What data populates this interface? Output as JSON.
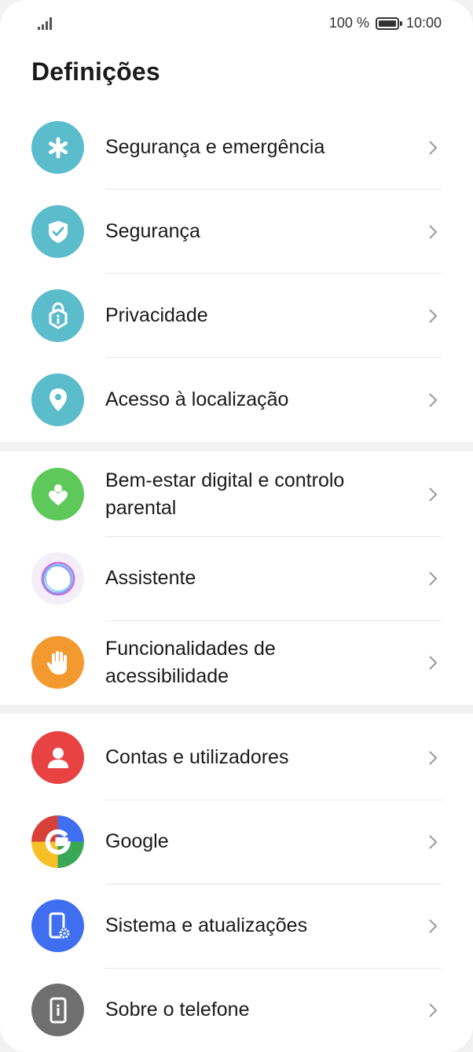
{
  "status_bar": {
    "battery_text": "100 %",
    "time": "10:00",
    "signal_icon": "signal-icon",
    "battery_icon": "battery-icon"
  },
  "page": {
    "title": "Definições"
  },
  "colors": {
    "teal": "#5bbccb",
    "green": "#5ec95a",
    "orange": "#f39a2f",
    "red": "#e84242",
    "blue": "#3f6ff0",
    "gray": "#6f6f6f"
  },
  "settings": {
    "items": [
      {
        "label": "Segurança e emergência",
        "icon": "asterisk-icon"
      },
      {
        "label": "Segurança",
        "icon": "shield-check-icon"
      },
      {
        "label": "Privacidade",
        "icon": "privacy-lock-icon"
      },
      {
        "label": "Acesso à localização",
        "icon": "location-pin-icon"
      },
      {
        "label_line1": "Bem-estar digital e controlo",
        "label_line2": "parental",
        "icon": "digital-wellbeing-icon"
      },
      {
        "label": "Assistente",
        "icon": "assistant-icon"
      },
      {
        "label_line1": "Funcionalidades de",
        "label_line2": "acessibilidade",
        "icon": "hand-icon"
      },
      {
        "label": "Contas e utilizadores",
        "icon": "user-icon"
      },
      {
        "label": "Google",
        "icon": "google-icon"
      },
      {
        "label": "Sistema e atualizações",
        "icon": "phone-gear-icon"
      },
      {
        "label": "Sobre o telefone",
        "icon": "phone-info-icon"
      }
    ]
  }
}
